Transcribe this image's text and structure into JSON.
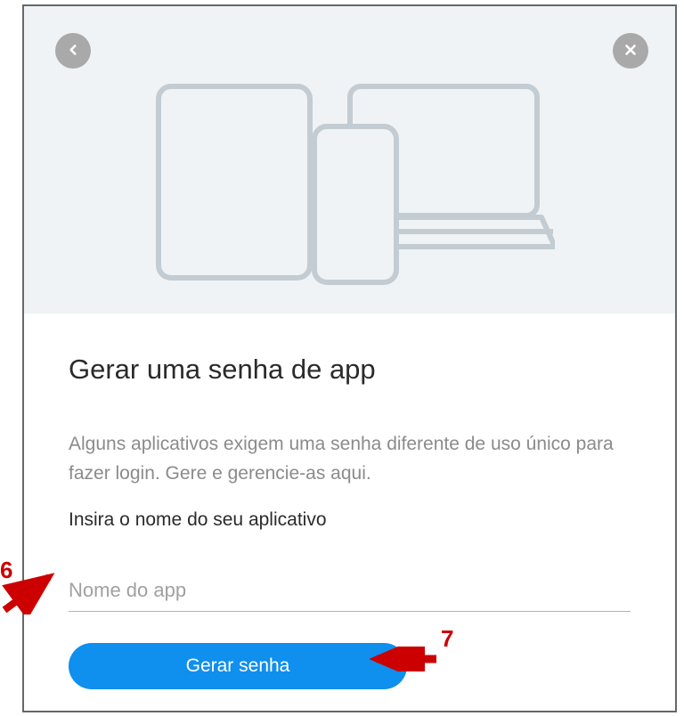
{
  "dialog": {
    "title": "Gerar uma senha de app",
    "description": "Alguns aplicativos exigem uma senha diferente de uso único para fazer login. Gere e gerencie-as aqui.",
    "instruction": "Insira o nome do seu aplicativo",
    "input_placeholder": "Nome do app",
    "generate_button": "Gerar senha"
  },
  "annotations": {
    "step6": "6",
    "step7": "7"
  }
}
